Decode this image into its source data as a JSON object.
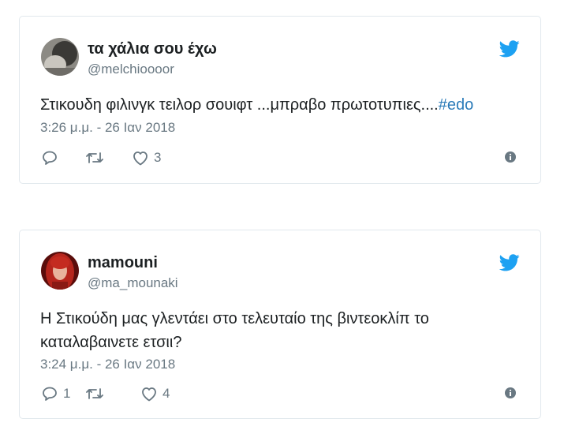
{
  "tweets": [
    {
      "display_name": "τα χάλια σου έχω",
      "handle": "@melchioooor",
      "text": "Στικουδη φιλινγκ τειλορ σουιφτ ...μπραβο πρωτοτυπιες....",
      "hashtag": "#edo",
      "timestamp": "3:26 μ.μ. - 26 Ιαν 2018",
      "reply_count": "",
      "retweet_count": "",
      "like_count": "3",
      "icons": [
        "reply-icon",
        "retweet-icon",
        "heart-icon",
        "info-icon",
        "twitter-bird-icon"
      ]
    },
    {
      "display_name": "mamouni",
      "handle": "@ma_mounaki",
      "text": "Η Στικούδη μας γλεντάει στο τελευταίο της βιντεοκλίπ το καταλαβαινετε ετσιι?",
      "hashtag": "",
      "timestamp": "3:24 μ.μ. - 26 Ιαν 2018",
      "reply_count": "1",
      "retweet_count": "",
      "like_count": "4",
      "icons": [
        "reply-icon",
        "retweet-icon",
        "heart-icon",
        "info-icon",
        "twitter-bird-icon"
      ]
    }
  ],
  "colors": {
    "text": "#1c2022",
    "muted": "#697882",
    "link": "#2b7bb9",
    "twitter_blue": "#1da1f2",
    "border": "#e1e8ed"
  }
}
